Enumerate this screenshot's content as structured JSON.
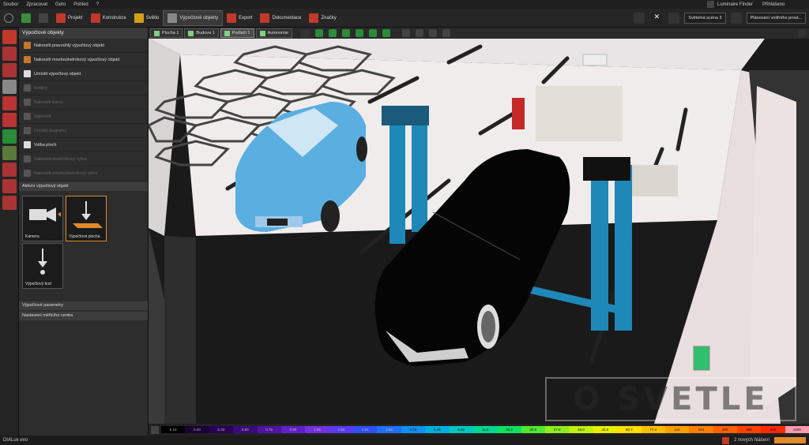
{
  "menu": [
    "Soubor",
    "Zpracovat",
    "Geto",
    "Pohled",
    "?"
  ],
  "topright": {
    "finder": "Luminaire Finder",
    "login": "Přihlášeno"
  },
  "toolbar": [
    {
      "label": "Projekt",
      "color": "#c0392b"
    },
    {
      "label": "Konstrukce",
      "color": "#c0392b"
    },
    {
      "label": "Světlo",
      "color": "#d4a017"
    },
    {
      "label": "Výpočtové objekty",
      "color": "#888"
    },
    {
      "label": "Export",
      "color": "#c0392b"
    },
    {
      "label": "Dokumentace",
      "color": "#c0392b"
    },
    {
      "label": "Značky",
      "color": "#c0392b"
    }
  ],
  "scene_select": "Světelná scéna 3",
  "plan_select": "Plánování vnitřního prost...",
  "panel": {
    "title": "Výpočtové objekty",
    "items": [
      {
        "label": "Nakreslit pravoúhlý výpočtový objekt",
        "enabled": true,
        "color": "#c4762b"
      },
      {
        "label": "Nakreslit mnohoúhelníkový výpočtový objekt",
        "enabled": true,
        "color": "#c4762b"
      },
      {
        "label": "Umístit výpočtový objekt",
        "enabled": true,
        "color": "#ddd"
      },
      {
        "label": "Bodiny",
        "enabled": false,
        "color": "#555"
      },
      {
        "label": "Nakreslit barvu",
        "enabled": false,
        "color": "#555"
      },
      {
        "label": "Nakreslit",
        "enabled": false,
        "color": "#555"
      },
      {
        "label": "Umístit diagramy",
        "enabled": false,
        "color": "#555"
      },
      {
        "label": "Volba ploch",
        "enabled": true,
        "color": "#ddd"
      },
      {
        "label": "Nakreslit obdélníkový výřez",
        "enabled": false,
        "color": "#555"
      },
      {
        "label": "Nakreslit mnohoúhelníkový výřez",
        "enabled": false,
        "color": "#555"
      }
    ],
    "active_title": "Aktivní výpočtový objekt",
    "tiles": [
      {
        "label": "Kamera"
      },
      {
        "label": "Výpočtová plocha"
      },
      {
        "label": "Výpočtový bod"
      }
    ],
    "sections": [
      "Výpočtové parametry",
      "Nastavení měřicího centra"
    ]
  },
  "viewtabs": [
    {
      "label": "Plocha 1",
      "active": false
    },
    {
      "label": "Budova 1",
      "active": false
    },
    {
      "label": "Podlaží 1",
      "active": true
    },
    {
      "label": "Autonomie",
      "active": false
    }
  ],
  "legend": [
    "0.10",
    "0.20",
    "0.33",
    "0.50",
    "0.75",
    "0.85",
    "1.96",
    "2.56",
    "2.94",
    "3.65",
    "4.72",
    "5.45",
    "6.90",
    "11.0",
    "16.3",
    "20.0",
    "27.0",
    "33.0",
    "42.0",
    "56.7",
    "77.4",
    "110",
    "154",
    "200",
    "300",
    "500",
    "1000"
  ],
  "legend_colors": [
    "#000",
    "#1a0033",
    "#2a0055",
    "#3b0a7a",
    "#4f14a3",
    "#6020c8",
    "#7530e0",
    "#5a3bf0",
    "#3050f5",
    "#2070f8",
    "#1090f0",
    "#00b0e0",
    "#00c8c0",
    "#00d890",
    "#10e060",
    "#50e830",
    "#90ec20",
    "#c0f010",
    "#e8f000",
    "#ffe000",
    "#ffc000",
    "#ffa000",
    "#ff8000",
    "#ff6000",
    "#ff4000",
    "#ff2800",
    "#ff9bb0"
  ],
  "status": {
    "app": "DIALux evo",
    "notice": "2 nových hlášení"
  },
  "watermark": "O SVETLE"
}
